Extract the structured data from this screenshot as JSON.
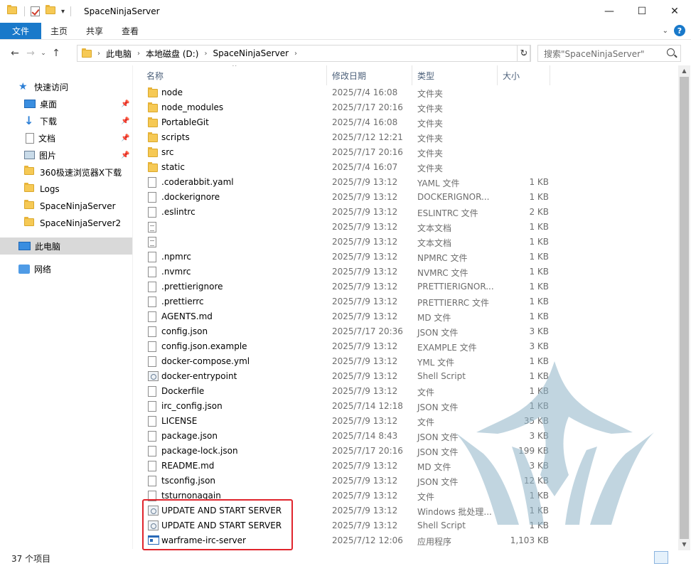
{
  "window": {
    "title": "SpaceNinjaServer",
    "controls": [
      "—",
      "☐",
      "✕"
    ]
  },
  "ribbon": {
    "tabs": [
      "文件",
      "主页",
      "共享",
      "查看"
    ],
    "help": "?"
  },
  "address": {
    "crumbs": [
      "此电脑",
      "本地磁盘 (D:)",
      "SpaceNinjaServer"
    ],
    "search_placeholder": "搜索\"SpaceNinjaServer\""
  },
  "nav": {
    "quick_access": "快速访问",
    "pinned": [
      {
        "label": "桌面",
        "icon": "desktop-icon"
      },
      {
        "label": "下载",
        "icon": "download-icon"
      },
      {
        "label": "文档",
        "icon": "document-icon"
      },
      {
        "label": "图片",
        "icon": "pictures-icon"
      }
    ],
    "recent": [
      "360极速浏览器X下载",
      "Logs",
      "SpaceNinjaServer",
      "SpaceNinjaServer2"
    ],
    "this_pc": "此电脑",
    "network": "网络"
  },
  "columns": {
    "name": "名称",
    "date": "修改日期",
    "type": "类型",
    "size": "大小"
  },
  "files": [
    {
      "name": "node",
      "date": "2025/7/4 16:08",
      "type": "文件夹",
      "size": "",
      "icon": "folder"
    },
    {
      "name": "node_modules",
      "date": "2025/7/17 20:16",
      "type": "文件夹",
      "size": "",
      "icon": "folder"
    },
    {
      "name": "PortableGit",
      "date": "2025/7/4 16:08",
      "type": "文件夹",
      "size": "",
      "icon": "folder"
    },
    {
      "name": "scripts",
      "date": "2025/7/12 12:21",
      "type": "文件夹",
      "size": "",
      "icon": "folder"
    },
    {
      "name": "src",
      "date": "2025/7/17 20:16",
      "type": "文件夹",
      "size": "",
      "icon": "folder"
    },
    {
      "name": "static",
      "date": "2025/7/4 16:07",
      "type": "文件夹",
      "size": "",
      "icon": "folder"
    },
    {
      "name": ".coderabbit.yaml",
      "date": "2025/7/9 13:12",
      "type": "YAML 文件",
      "size": "1 KB",
      "icon": "file"
    },
    {
      "name": ".dockerignore",
      "date": "2025/7/9 13:12",
      "type": "DOCKERIGNOR...",
      "size": "1 KB",
      "icon": "file"
    },
    {
      "name": ".eslintrc",
      "date": "2025/7/9 13:12",
      "type": "ESLINTRC 文件",
      "size": "2 KB",
      "icon": "file"
    },
    {
      "name": "",
      "date": "2025/7/9 13:12",
      "type": "文本文档",
      "size": "1 KB",
      "icon": "text"
    },
    {
      "name": "",
      "date": "2025/7/9 13:12",
      "type": "文本文档",
      "size": "1 KB",
      "icon": "text"
    },
    {
      "name": ".npmrc",
      "date": "2025/7/9 13:12",
      "type": "NPMRC 文件",
      "size": "1 KB",
      "icon": "file"
    },
    {
      "name": ".nvmrc",
      "date": "2025/7/9 13:12",
      "type": "NVMRC 文件",
      "size": "1 KB",
      "icon": "file"
    },
    {
      "name": ".prettierignore",
      "date": "2025/7/9 13:12",
      "type": "PRETTIERIGNOR...",
      "size": "1 KB",
      "icon": "file"
    },
    {
      "name": ".prettierrc",
      "date": "2025/7/9 13:12",
      "type": "PRETTIERRC 文件",
      "size": "1 KB",
      "icon": "file"
    },
    {
      "name": "AGENTS.md",
      "date": "2025/7/9 13:12",
      "type": "MD 文件",
      "size": "1 KB",
      "icon": "file"
    },
    {
      "name": "config.json",
      "date": "2025/7/17 20:36",
      "type": "JSON 文件",
      "size": "3 KB",
      "icon": "file"
    },
    {
      "name": "config.json.example",
      "date": "2025/7/9 13:12",
      "type": "EXAMPLE 文件",
      "size": "3 KB",
      "icon": "file"
    },
    {
      "name": "docker-compose.yml",
      "date": "2025/7/9 13:12",
      "type": "YML 文件",
      "size": "1 KB",
      "icon": "file"
    },
    {
      "name": "docker-entrypoint",
      "date": "2025/7/9 13:12",
      "type": "Shell Script",
      "size": "1 KB",
      "icon": "script"
    },
    {
      "name": "Dockerfile",
      "date": "2025/7/9 13:12",
      "type": "文件",
      "size": "1 KB",
      "icon": "file"
    },
    {
      "name": "irc_config.json",
      "date": "2025/7/14 12:18",
      "type": "JSON 文件",
      "size": "1 KB",
      "icon": "file"
    },
    {
      "name": "LICENSE",
      "date": "2025/7/9 13:12",
      "type": "文件",
      "size": "35 KB",
      "icon": "file"
    },
    {
      "name": "package.json",
      "date": "2025/7/14 8:43",
      "type": "JSON 文件",
      "size": "3 KB",
      "icon": "file"
    },
    {
      "name": "package-lock.json",
      "date": "2025/7/17 20:16",
      "type": "JSON 文件",
      "size": "199 KB",
      "icon": "file"
    },
    {
      "name": "README.md",
      "date": "2025/7/9 13:12",
      "type": "MD 文件",
      "size": "3 KB",
      "icon": "file"
    },
    {
      "name": "tsconfig.json",
      "date": "2025/7/9 13:12",
      "type": "JSON 文件",
      "size": "12 KB",
      "icon": "file"
    },
    {
      "name": "tsturnonagain",
      "date": "2025/7/9 13:12",
      "type": "文件",
      "size": "1 KB",
      "icon": "file"
    },
    {
      "name": "UPDATE AND START SERVER",
      "date": "2025/7/9 13:12",
      "type": "Windows 批处理...",
      "size": "1 KB",
      "icon": "script"
    },
    {
      "name": "UPDATE AND START SERVER",
      "date": "2025/7/9 13:12",
      "type": "Shell Script",
      "size": "1 KB",
      "icon": "script"
    },
    {
      "name": "warframe-irc-server",
      "date": "2025/7/12 12:06",
      "type": "应用程序",
      "size": "1,103 KB",
      "icon": "exe"
    }
  ],
  "status": {
    "item_count": "37 个项目"
  },
  "colors": {
    "accent": "#1979ca",
    "highlight_box": "#e0242c",
    "watermark": "#8fb4c8"
  }
}
